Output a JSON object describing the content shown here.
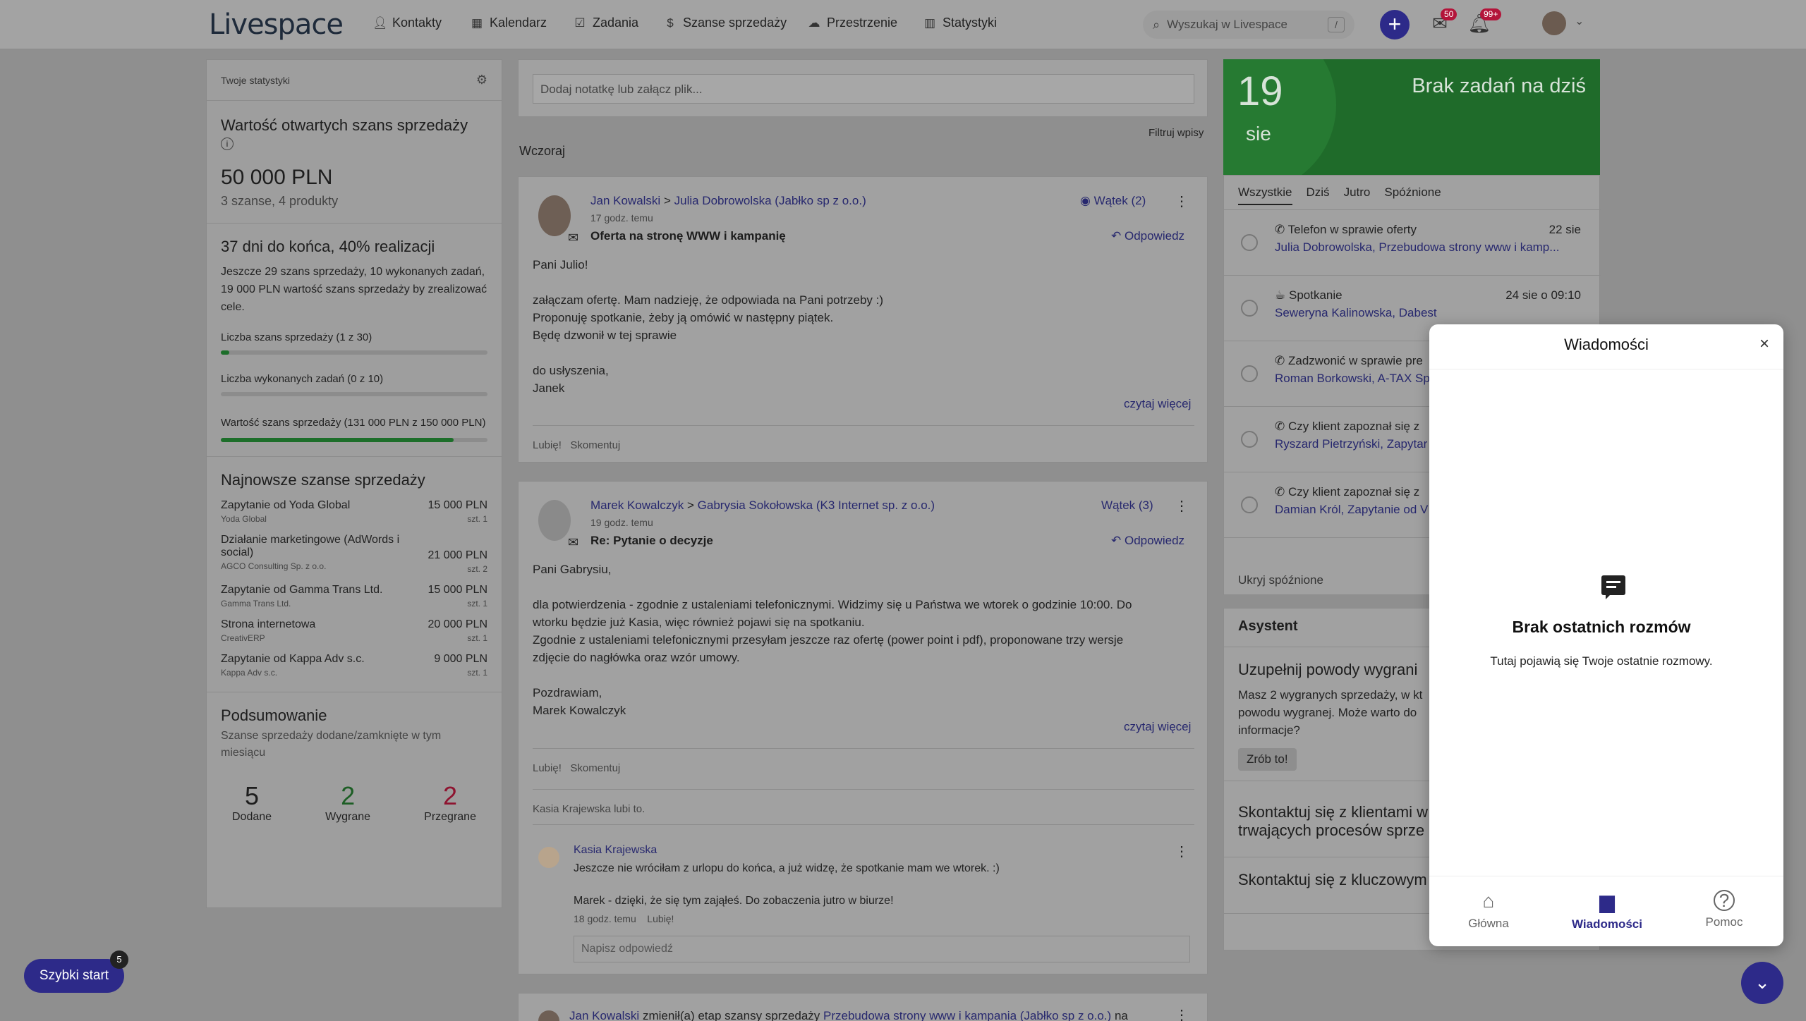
{
  "topbar": {
    "logo": "Livespace",
    "nav": [
      {
        "label": "Kontakty",
        "icon": "person-icon"
      },
      {
        "label": "Kalendarz",
        "icon": "calendar-icon"
      },
      {
        "label": "Zadania",
        "icon": "checkbox-icon"
      },
      {
        "label": "Szanse sprzedaży",
        "icon": "dollar-icon"
      },
      {
        "label": "Przestrzenie",
        "icon": "cloud-icon"
      },
      {
        "label": "Statystyki",
        "icon": "chart-icon"
      }
    ],
    "search_placeholder": "Wyszukaj w Livespace",
    "search_shortcut": "/",
    "inbox_badge": "50",
    "notif_badge": "99+"
  },
  "stats": {
    "header": "Twoje statystyki",
    "open_title": "Wartość otwartych szans sprzedaży",
    "open_value": "50 000 PLN",
    "open_sub": "3 szanse,  4 produkty",
    "days_title": "37 dni do końca, 40% realizacji",
    "days_text": "Jeszcze 29 szans sprzedaży, 10 wykonanych zadań, 19 000 PLN wartość szans sprzedaży by zrealizować cele.",
    "goal1": "Liczba szans sprzedaży (1 z 30)",
    "goal1_progress": 0.033,
    "goal2": "Liczba wykonanych zadań (0 z 10)",
    "goal2_progress": 0,
    "goal3": "Wartość szans sprzedaży (131 000 PLN z 150 000 PLN)",
    "goal3_progress": 0.873,
    "latest_title": "Najnowsze szanse sprzedaży",
    "latest": [
      {
        "name": "Zapytanie od Yoda Global",
        "company": "Yoda Global",
        "value": "15 000 PLN",
        "qty": "szt. 1"
      },
      {
        "name": "Działanie marketingowe (AdWords i social)",
        "company": "AGCO Consulting Sp. z o.o.",
        "value": "21 000 PLN",
        "qty": "szt. 2"
      },
      {
        "name": "Zapytanie od Gamma Trans Ltd.",
        "company": "Gamma Trans Ltd.",
        "value": "15 000 PLN",
        "qty": "szt. 1"
      },
      {
        "name": "Strona internetowa",
        "company": "CreativERP",
        "value": "20 000 PLN",
        "qty": "szt. 1"
      },
      {
        "name": "Zapytanie od Kappa Adv s.c.",
        "company": "Kappa Adv s.c.",
        "value": "9 000 PLN",
        "qty": "szt. 1"
      }
    ],
    "summary_title": "Podsumowanie",
    "summary_sub": "Szanse sprzedaży dodane/zamknięte w tym miesiącu",
    "added": "5",
    "added_label": "Dodane",
    "won": "2",
    "won_label": "Wygrane",
    "lost": "2",
    "lost_label": "Przegrane"
  },
  "feed": {
    "note_placeholder": "Dodaj notatkę lub załącz plik...",
    "filter": "Filtruj wpisy",
    "day": "Wczoraj",
    "post1": {
      "author": "Jan Kowalski",
      "sep": ">",
      "target": "Julia Dobrowolska (Jabłko sp z o.o.)",
      "time": "17 godz. temu",
      "subject": "Oferta na stronę WWW i kampanię",
      "thread": "Wątek (2)",
      "reply": "Odpowiedz",
      "body": [
        "Pani Julio!",
        "",
        "załączam ofertę. Mam nadzieję, że odpowiada na Pani potrzeby :)",
        "Proponuję spotkanie, żeby ją omówić w następny piątek.",
        "Będę dzwonił w tej sprawie",
        "",
        "do usłyszenia,",
        "Janek"
      ],
      "more": "czytaj więcej",
      "like": "Lubię!",
      "comment": "Skomentuj"
    },
    "post2": {
      "author": "Marek Kowalczyk",
      "sep": ">",
      "target": "Gabrysia Sokołowska (K3 Internet sp. z o.o.)",
      "time": "19 godz. temu",
      "subject": "Re: Pytanie o decyzje",
      "thread": "Wątek (3)",
      "reply": "Odpowiedz",
      "body": [
        "Pani Gabrysiu,",
        "",
        "dla potwierdzenia - zgodnie z ustaleniami telefonicznymi. Widzimy się u Państwa we wtorek o godzinie 10:00. Do",
        "wtorku będzie już Kasia, więc również pojawi się na spotkaniu.",
        "Zgodnie z ustaleniami telefonicznymi przesyłam jeszcze raz ofertę (power point i pdf), proponowane trzy wersje",
        "zdjęcie do nagłówka oraz wzór umowy.",
        "",
        "Pozdrawiam,",
        "Marek Kowalczyk"
      ],
      "more": "czytaj więcej",
      "like": "Lubię!",
      "comment": "Skomentuj",
      "liked_by": "Kasia Krajewska",
      "liked_suffix": "lubi to.",
      "c_author": "Kasia Krajewska",
      "c_text1": "Jeszcze nie wróciłam z urlopu do końca, a już widzę, że spotkanie mam we wtorek. :)",
      "c_text2": "Marek - dzięki, że się tym zająłeś. Do zobaczenia jutro w biurze!",
      "c_time": "18 godz. temu",
      "c_like": "Lubię!",
      "reply_placeholder": "Napisz odpowiedź"
    },
    "post3": {
      "author": "Jan Kowalski",
      "mid": "zmienił(a) etap szansy sprzedaży",
      "target": "Przebudowa strony www i kampania (Jabłko sp z o.o.)",
      "end": "na"
    }
  },
  "tasks": {
    "day": "19",
    "month": "sie",
    "empty": "Brak zadań na dziś",
    "tabs": [
      "Wszystkie",
      "Dziś",
      "Jutro",
      "Spóźnione"
    ],
    "items": [
      {
        "title": "Telefon w sprawie oferty",
        "date": "22 sie",
        "people": "Julia Dobrowolska, Przebudowa strony www i kamp...",
        "icon": "phone-icon"
      },
      {
        "title": "Spotkanie",
        "date": "24 sie o 09:10",
        "people": "Seweryna Kalinowska, Dabest",
        "icon": "meeting-icon"
      },
      {
        "title": "Zadzwonić w sprawie pre",
        "date": "",
        "people": "Roman Borkowski, A-TAX Sp",
        "icon": "phone-icon"
      },
      {
        "title": "Czy klient zapoznał się z",
        "date": "",
        "people": "Ryszard Pietrzyński, Zapytar",
        "icon": "phone-icon"
      },
      {
        "title": "Czy klient zapoznał się z",
        "date": "",
        "people": "Damian Król, Zapytanie od V",
        "icon": "phone-icon"
      },
      {
        "title": "Czy klient zapoznał się z",
        "date": "",
        "people": "",
        "icon": "phone-icon"
      }
    ],
    "hide_late": "Ukryj spóźnione"
  },
  "assistant": {
    "title": "Asystent",
    "card1_title": "Uzupełnij powody wygrani",
    "card1_text": "Masz 2 wygranych sprzedaży, w kt powodu wygranej. Może warto do informacje?",
    "card1_btn": "Zrób to!",
    "card2_title": "Skontaktuj się z klientami w trwających procesów sprze",
    "card3_title": "Skontaktuj się z kluczowym"
  },
  "modal": {
    "title": "Wiadomości",
    "empty_title": "Brak ostatnich rozmów",
    "empty_text": "Tutaj pojawią się Twoje ostatnie rozmowy.",
    "tabs": [
      "Główna",
      "Wiadomości",
      "Pomoc"
    ],
    "active_color": "#2d2a89"
  },
  "quick_start": {
    "label": "Szybki start",
    "count": "5"
  }
}
